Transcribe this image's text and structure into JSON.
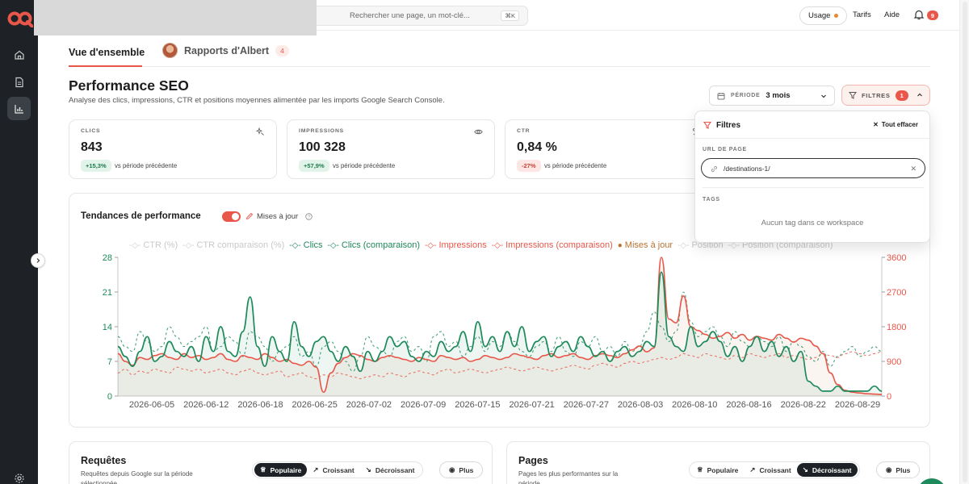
{
  "colors": {
    "accent": "#e8574a",
    "green": "#1e8a5b",
    "sidebar": "#1e2226",
    "orange_dot": "#e8892b"
  },
  "sidebar": {
    "logo": "logo-icon",
    "items": [
      {
        "icon": "home-icon"
      },
      {
        "icon": "document-icon"
      },
      {
        "icon": "chart-icon",
        "active": true
      }
    ],
    "bottom_icon": "settings-icon"
  },
  "topbar": {
    "search_placeholder": "Rechercher une page, un mot-clé...",
    "search_shortcut": "⌘K",
    "usage_label": "Usage",
    "links": [
      "Tarifs",
      "Aide"
    ],
    "notifications_count": "9"
  },
  "tabs": [
    {
      "label": "Vue d'ensemble",
      "active": true
    },
    {
      "label": "Rapports d'Albert",
      "count": "4"
    }
  ],
  "header": {
    "title": "Performance SEO",
    "subtitle": "Analyse des clics, impressions, CTR et positions moyennes alimentée par les imports Google Search Console.",
    "period_label": "PÉRIODE",
    "period_value": "3 mois",
    "filters_label": "FILTRES",
    "filters_count": "1"
  },
  "metrics": [
    {
      "label": "CLICS",
      "value": "843",
      "delta": "+15,3%",
      "direction": "up",
      "vs": "vs période précédente",
      "icon": "sparkle-icon"
    },
    {
      "label": "IMPRESSIONS",
      "value": "100 328",
      "delta": "+57,9%",
      "direction": "up",
      "vs": "vs période précédente",
      "icon": "eye-icon"
    },
    {
      "label": "CTR",
      "value": "0,84 %",
      "delta": "-27%",
      "direction": "down",
      "vs": "vs période précédente",
      "icon": "percent-icon"
    }
  ],
  "chart_card": {
    "title": "Tendances de performance",
    "toggle_label": "Mises à jour",
    "toggle_on": true
  },
  "filters_dropdown": {
    "title": "Filtres",
    "clear_label": "Tout effacer",
    "url_section": "URL DE PAGE",
    "url_value": "/destinations-1/",
    "tags_section": "TAGS",
    "tags_empty": "Aucun tag dans ce workspace"
  },
  "chart_data": {
    "type": "line",
    "legend": [
      {
        "name": "CTR (%)",
        "color": "#cfcfcf",
        "active": false
      },
      {
        "name": "CTR comparaison (%)",
        "color": "#cfcfcf",
        "active": false
      },
      {
        "name": "Clics",
        "color": "#1e8a5b",
        "active": true
      },
      {
        "name": "Clics (comparaison)",
        "color": "#1e8a5b",
        "active": true
      },
      {
        "name": "Impressions",
        "color": "#e8574a",
        "active": true
      },
      {
        "name": "Impressions (comparaison)",
        "color": "#e8574a",
        "active": true
      },
      {
        "name": "Mises à jour",
        "color": "#b87333",
        "active": true
      },
      {
        "name": "Position",
        "color": "#cfcfcf",
        "active": false
      },
      {
        "name": "Position (comparaison)",
        "color": "#cfcfcf",
        "active": false
      }
    ],
    "x_ticks": [
      "2026-06-05",
      "2026-06-12",
      "2026-06-18",
      "2026-06-25",
      "2026-07-02",
      "2026-07-09",
      "2026-07-15",
      "2026-07-21",
      "2026-07-27",
      "2026-08-03",
      "2026-08-10",
      "2026-08-16",
      "2026-08-22",
      "2026-08-29"
    ],
    "y_left_ticks": [
      0,
      7,
      14,
      21,
      28
    ],
    "y_right_ticks": [
      0,
      900,
      1800,
      2700,
      3600
    ],
    "ylim_left": [
      0,
      28
    ],
    "ylim_right": [
      0,
      3600
    ],
    "clics": [
      10,
      8,
      6,
      9,
      12,
      7,
      8,
      11,
      9,
      8,
      10,
      7,
      12,
      9,
      14,
      9,
      8,
      13,
      20,
      10,
      6,
      12,
      9,
      7,
      15,
      10,
      8,
      11,
      12,
      9,
      7,
      10,
      8,
      5,
      9,
      7,
      9,
      12,
      10,
      11,
      8,
      7,
      9,
      8,
      11,
      9,
      10,
      13,
      9,
      15,
      10,
      12,
      9,
      13,
      10,
      14,
      9,
      11,
      12,
      8,
      10,
      11,
      9,
      12,
      10,
      8,
      9,
      7,
      9,
      10,
      8,
      9,
      11,
      10,
      25,
      12,
      10,
      9,
      14,
      10,
      11,
      13,
      11,
      8,
      10,
      7,
      10,
      12,
      9,
      11,
      8,
      10,
      7,
      9,
      3,
      2,
      1,
      1,
      2,
      1,
      1,
      1,
      1,
      2,
      1
    ],
    "clics_comparaison": [
      12,
      10,
      9,
      13,
      11,
      9,
      10,
      14,
      12,
      10,
      11,
      12,
      14,
      9,
      10,
      12,
      11,
      8,
      13,
      12,
      10,
      7,
      9,
      10,
      12,
      8,
      9,
      6,
      10,
      11,
      9,
      7,
      5,
      8,
      12,
      10,
      9,
      8,
      11,
      12,
      9,
      10,
      7,
      12,
      13,
      10,
      11,
      8,
      10,
      12,
      9,
      11,
      10,
      13,
      11,
      9,
      8,
      10,
      11,
      9,
      12,
      9,
      8,
      11,
      10,
      12,
      9,
      10,
      8,
      11,
      9,
      10,
      13,
      17,
      14,
      11,
      13,
      21,
      15,
      12,
      13,
      14,
      12,
      10,
      13,
      11,
      10,
      12,
      11,
      10,
      12,
      9,
      11,
      10,
      8,
      7,
      9,
      6,
      8,
      9,
      10,
      8,
      9,
      10,
      9
    ],
    "impressions": [
      1100,
      900,
      800,
      1000,
      950,
      1050,
      1100,
      1000,
      950,
      1100,
      1000,
      1050,
      950,
      1000,
      1100,
      950,
      900,
      1050,
      1000,
      950,
      1100,
      1000,
      900,
      950,
      850,
      800,
      900,
      750,
      100,
      600,
      850,
      1000,
      1100,
      1050,
      950,
      900,
      1000,
      1050,
      1000,
      950,
      900,
      1000,
      950,
      900,
      1050,
      1000,
      950,
      1000,
      900,
      950,
      1050,
      1000,
      950,
      1000,
      1100,
      1050,
      1000,
      950,
      1050,
      1100,
      1000,
      1050,
      1100,
      1000,
      950,
      1050,
      1100,
      1050,
      1000,
      1100,
      1200,
      1300,
      1150,
      1250,
      3600,
      2000,
      1900,
      2600,
      1800,
      1700,
      1600,
      1500,
      1550,
      1650,
      1500,
      1600,
      1450,
      1550,
      1500,
      1450,
      1600,
      1500,
      1400,
      1500,
      1450,
      1300,
      1100,
      600,
      300,
      150,
      100,
      80,
      60,
      50,
      40
    ],
    "impressions_comparaison": [
      600,
      700,
      550,
      650,
      600,
      700,
      650,
      600,
      750,
      700,
      650,
      700,
      600,
      650,
      700,
      600,
      550,
      650,
      700,
      600,
      550,
      600,
      650,
      500,
      550,
      600,
      500,
      450,
      550,
      500,
      600,
      550,
      500,
      450,
      500,
      550,
      500,
      600,
      550,
      500,
      600,
      650,
      600,
      550,
      650,
      700,
      600,
      650,
      700,
      650,
      600,
      650,
      700,
      750,
      700,
      650,
      700,
      750,
      700,
      650,
      700,
      750,
      800,
      750,
      700,
      800,
      850,
      800,
      750,
      850,
      900,
      850,
      900,
      950,
      1000,
      950,
      1000,
      1100,
      1050,
      1000,
      1100,
      1050,
      1000,
      950,
      1050,
      1000,
      1100,
      1050,
      1000,
      1050,
      1100,
      1000,
      1050,
      1000,
      950,
      1000,
      1100,
      1050,
      1000,
      1100,
      1150,
      1100,
      1050,
      1100,
      1150
    ]
  },
  "bottom": {
    "requetes": {
      "title": "Requêtes",
      "subtitle": "Requêtes depuis Google sur la période sélectionnée.",
      "segments": [
        {
          "label": "Populaire",
          "icon": "trophy-icon",
          "active": true
        },
        {
          "label": "Croissant",
          "icon": "trend-up-icon",
          "active": false
        },
        {
          "label": "Décroissant",
          "icon": "trend-down-icon",
          "active": false
        }
      ],
      "more_label": "Plus"
    },
    "pages": {
      "title": "Pages",
      "subtitle": "Pages les plus performantes sur la période.",
      "segments": [
        {
          "label": "Populaire",
          "icon": "trophy-icon",
          "active": false
        },
        {
          "label": "Croissant",
          "icon": "trend-up-icon",
          "active": false
        },
        {
          "label": "Décroissant",
          "icon": "trend-down-icon",
          "active": true
        }
      ],
      "more_label": "Plus"
    }
  }
}
